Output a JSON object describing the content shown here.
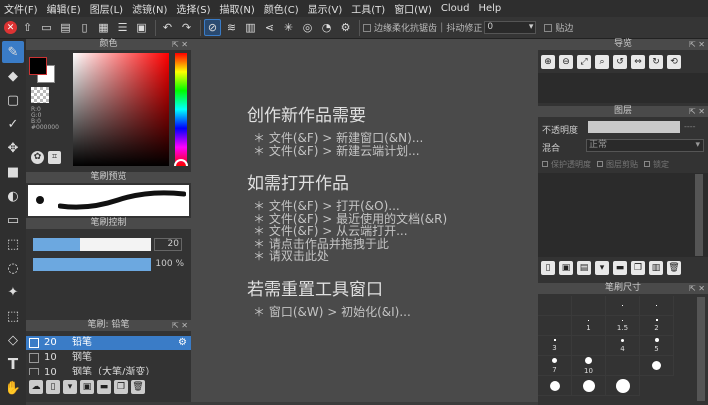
{
  "menu": {
    "items": [
      "文件(F)",
      "编辑(E)",
      "图层(L)",
      "滤镜(N)",
      "选择(S)",
      "描取(N)",
      "颜色(C)",
      "显示(V)",
      "工具(T)",
      "窗口(W)",
      "Cloud",
      "Help"
    ]
  },
  "toolbar": {
    "antialias_label": "边缘柔化抗锯齿",
    "stabilizer_label": "抖动修正",
    "stabilizer_value": "0",
    "snap_label": "贴边"
  },
  "panels": {
    "color": {
      "title": "颜色",
      "readout_r": "R:0",
      "readout_g": "G:0",
      "readout_b": "B:0",
      "hex": "#000000",
      "primary_color": "#000000",
      "secondary_color": "#ffffff"
    },
    "brush_preview": {
      "title": "笔刷预览"
    },
    "brush_control": {
      "title": "笔刷控制",
      "size_value": "20",
      "size_fill": 0.4,
      "opacity_value": "100 %",
      "opacity_fill": 1.0
    },
    "brush": {
      "title": "笔刷: 铅笔",
      "items": [
        {
          "size": "20",
          "name": "铅笔"
        },
        {
          "size": "10",
          "name": "钢笔"
        },
        {
          "size": "10",
          "name": "钢笔（大笔/渐变）"
        }
      ]
    },
    "navigator": {
      "title": "导览"
    },
    "layers": {
      "title": "图层",
      "opacity_label": "不透明度",
      "opacity_value": "----",
      "blend_label": "混合",
      "blend_value": "正常",
      "protect_alpha": "保护透明度",
      "clipping": "图层剪贴",
      "lock": "锁定"
    },
    "brush_size": {
      "title": "笔刷尺寸",
      "labels": [
        "1",
        "1.5",
        "2",
        "3",
        "4",
        "5",
        "7",
        "10"
      ]
    }
  },
  "canvas": {
    "new_heading": "创作新作品需要",
    "new_lines": [
      "＊ 文件(&F) > 新建窗口(&N)...",
      "＊ 文件(&F) > 新建云端计划..."
    ],
    "open_heading": "如需打开作品",
    "open_lines": [
      "＊ 文件(&F) > 打开(&O)...",
      "＊ 文件(&F) > 最近使用的文档(&R)",
      "＊ 文件(&F) > 从云端打开...",
      "＊ 请点击作品并拖拽于此",
      "＊ 请双击此处"
    ],
    "reset_heading": "若需重置工具窗口",
    "reset_lines": [
      "＊ 窗口(&W) > 初始化(&I)..."
    ]
  },
  "colors": {
    "accent": "#3a7cc7"
  }
}
